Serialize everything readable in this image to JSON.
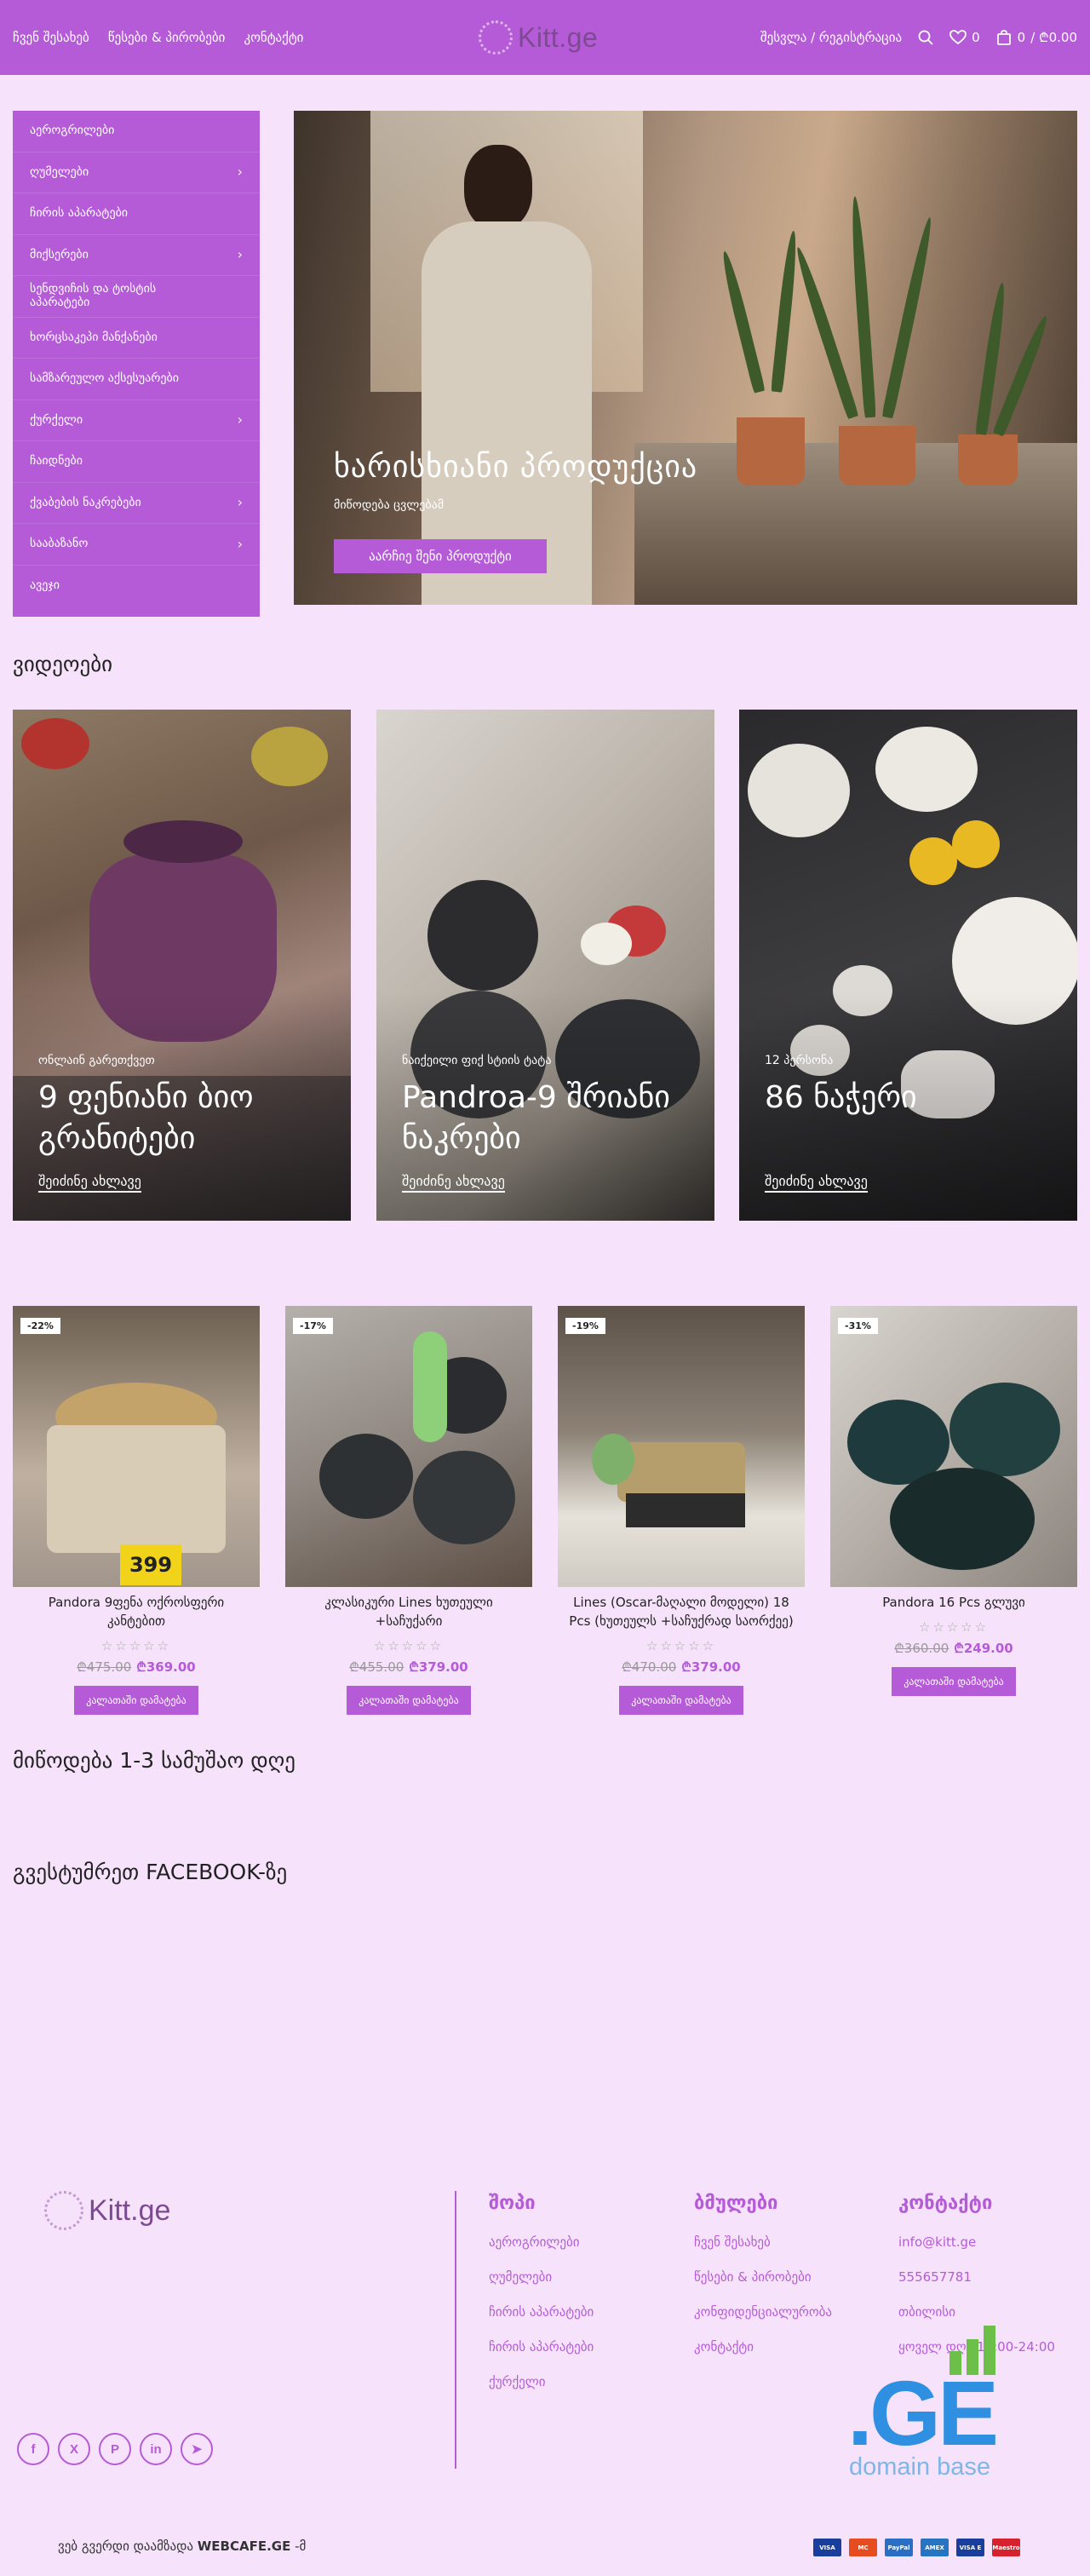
{
  "header": {
    "nav": [
      "ჩვენ შესახებ",
      "წესები & პირობები",
      "კონტაქტი"
    ],
    "logo_text": "Kitt.ge",
    "login": "შესვლა / რეგისტრაცია",
    "wishlist_count": "0",
    "cart_count": "0",
    "cart_total": "/ ₾0.00"
  },
  "sidebar": {
    "items": [
      {
        "label": "აეროგრილები",
        "chevron": ""
      },
      {
        "label": "ღუმელები",
        "chevron": "›"
      },
      {
        "label": "ჩირის აპარატები",
        "chevron": ""
      },
      {
        "label": "მიქსერები",
        "chevron": "›"
      },
      {
        "label": "სენდვიჩის და ტოსტის აპარატები",
        "chevron": ""
      },
      {
        "label": "ხორცსაკეპი მანქანები",
        "chevron": ""
      },
      {
        "label": "სამზარეულო აქსესუარები",
        "chevron": ""
      },
      {
        "label": "ქურქელი",
        "chevron": "›"
      },
      {
        "label": "ჩაიდნები",
        "chevron": ""
      },
      {
        "label": "ქვაბების ნაკრებები",
        "chevron": "›"
      },
      {
        "label": "სააბაზანო",
        "chevron": "›"
      },
      {
        "label": "ავეჯი",
        "chevron": ""
      }
    ]
  },
  "hero": {
    "title": "ხარისხიანი პროდუქცია",
    "subtitle": "მიწოდება ცვლებამ",
    "button": "აარჩიე შენი პროდუქტი"
  },
  "videos": {
    "title": "ვიდეოები",
    "cards": [
      {
        "tag": "ონლაინ გარეთქვეთ",
        "title": "9 ფენიანი ბიო გრანიტები",
        "link": "შეიძინე ახლავე"
      },
      {
        "tag": "ნაიქეილი ფიქ სტიის ტატა",
        "title": "Pandroa-9 შრიანი ნაკრები",
        "link": "შეიძინე ახლავე"
      },
      {
        "tag": "12 პერსონა",
        "title": "86 ნაჭერი",
        "link": "შეიძინე ახლავე"
      }
    ]
  },
  "products": [
    {
      "badge": "-22%",
      "name": "Pandora 9ფენა ოქროსფერი კანტებით",
      "old_price": "₾475.00",
      "new_price": "₾369.00",
      "button": "კალათაში დამატება",
      "sticker": "399"
    },
    {
      "badge": "-17%",
      "name": "კლასიკური Lines ხუთეული +საჩუქარი",
      "old_price": "₾455.00",
      "new_price": "₾379.00",
      "button": "კალათაში დამატება"
    },
    {
      "badge": "-19%",
      "name": "Lines (Oscar-მაღალი მოდელი) 18 Pcs (ხუთეულს +საჩუქრად საორქეე)",
      "old_price": "₾470.00",
      "new_price": "₾379.00",
      "button": "კალათაში დამატება"
    },
    {
      "badge": "-31%",
      "name": "Pandora 16 Pcs გლუვი",
      "old_price": "₾360.00",
      "new_price": "₾249.00",
      "button": "კალათაში დამატება"
    }
  ],
  "delivery_title": "მიწოდება 1-3 სამუშაო დღე",
  "facebook_title": "გვესტუმრეთ FACEBOOK-ზე",
  "footer": {
    "logo_text": "Kitt.ge",
    "socials": [
      "f",
      "X",
      "P",
      "in",
      "➤"
    ],
    "shop": {
      "title": "შოპი",
      "links": [
        "აეროგრილები",
        "ღუმელები",
        "ჩირის აპარატები",
        "ჩირის აპარატები",
        "ქურქელი"
      ]
    },
    "links": {
      "title": "ბმულები",
      "links": [
        "ჩვენ შესახებ",
        "წესები & პირობები",
        "კონფიდენციალურობა",
        "კონტაქტი"
      ]
    },
    "contact": {
      "title": "კონტაქტი",
      "items": [
        "info@kitt.ge",
        "555657781",
        "თბილისი",
        "ყოველ დღე 10:00-24:00"
      ]
    },
    "ge_logo_text": ".GE",
    "ge_logo_sub": "domain base",
    "copyright_prefix": "ვებ გვერდი დაამზადა",
    "copyright_brand": "WEBCAFE.GE",
    "copyright_suffix": "-მ",
    "payments": [
      {
        "name": "VISA",
        "color": "#1a3e9c"
      },
      {
        "name": "MC",
        "color": "#e64c1f"
      },
      {
        "name": "PayPal",
        "color": "#2b6fc4"
      },
      {
        "name": "AMEX",
        "color": "#2674c2"
      },
      {
        "name": "VISA E",
        "color": "#1a3e9c"
      },
      {
        "name": "Maestro",
        "color": "#d6212e"
      }
    ]
  }
}
